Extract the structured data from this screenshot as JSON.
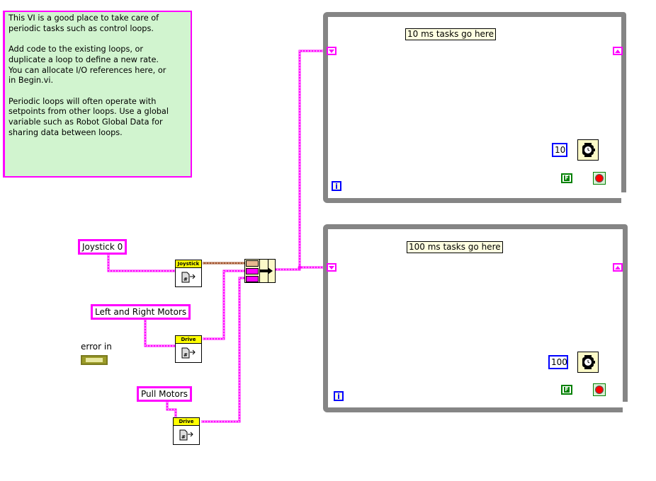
{
  "comment": {
    "text": "This VI is a good place to take care of\nperiodic tasks such as control loops.\n\nAdd code to the existing loops, or\nduplicate a loop to define a new rate.\nYou can allocate I/O references here, or\nin Begin.vi.\n\nPeriodic loops will often operate with\nsetpoints from other loops. Use a global\nvariable such as Robot Global Data for\nsharing data between loops."
  },
  "loops": [
    {
      "label": "10 ms tasks go here",
      "wait_ms": "10",
      "stop_constant": "F",
      "iteration_terminal": "i"
    },
    {
      "label": "100 ms tasks go here",
      "wait_ms": "100",
      "stop_constant": "F",
      "iteration_terminal": "i"
    }
  ],
  "constants": {
    "joystick": "Joystick 0",
    "drive_motors": "Left and Right Motors",
    "pull_motors": "Pull Motors"
  },
  "subvis": {
    "joystick_get": "Joystick",
    "drive_get_1": "Drive",
    "drive_get_2": "Drive"
  },
  "error_in": {
    "label": "error in"
  },
  "colors": {
    "string_wire": "#ff00ff",
    "refnum_wire": "#a0522d",
    "loop_border": "#858585",
    "comment_bg": "#d1f4cf",
    "numeric": "#0000ff",
    "boolean": "#008000"
  }
}
